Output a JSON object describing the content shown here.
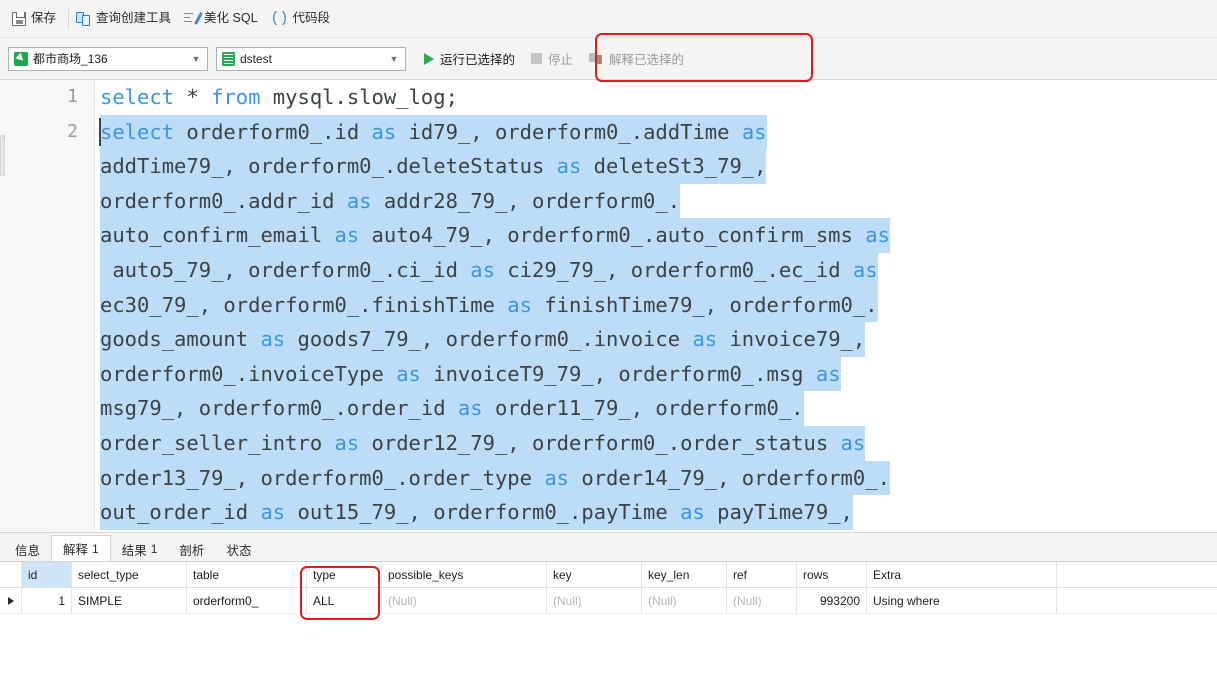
{
  "toolbar_top": {
    "items": [
      {
        "label": "保存",
        "icon": "save-icon"
      },
      {
        "label": "查询创建工具",
        "icon": "query-builder-icon"
      },
      {
        "label": "美化 SQL",
        "icon": "beautify-sql-icon"
      },
      {
        "label": "代码段",
        "icon": "code-snippet-icon"
      }
    ]
  },
  "toolbar_second": {
    "connection": {
      "value": "都市商场_136",
      "icon": "connection-icon",
      "arrow": "▼"
    },
    "database": {
      "value": "dstest",
      "icon": "database-icon",
      "arrow": "▼"
    },
    "run_selected": {
      "label": "运行已选择的",
      "icon": "run-icon",
      "enabled": true
    },
    "stop": {
      "label": "停止",
      "icon": "stop-icon",
      "enabled": false
    },
    "explain_selected": {
      "label": "解释已选择的",
      "icon": "explain-icon",
      "enabled": false
    }
  },
  "editor": {
    "lines": [
      {
        "number": "1",
        "selected": false,
        "parts": [
          {
            "t": "select",
            "k": true
          },
          {
            "t": " * ",
            "k": false
          },
          {
            "t": "from",
            "k": true
          },
          {
            "t": " mysql.slow_log;",
            "k": false
          }
        ]
      },
      {
        "number": "2",
        "selected": true,
        "parts": [
          {
            "t": "select",
            "k": true
          },
          {
            "t": " orderform0_.id ",
            "k": false
          },
          {
            "t": "as",
            "k": true
          },
          {
            "t": " id79_, orderform0_.addTime ",
            "k": false
          },
          {
            "t": "as",
            "k": true
          }
        ]
      },
      {
        "number": "",
        "selected": true,
        "parts": [
          {
            "t": "addTime79_, orderform0_.deleteStatus ",
            "k": false
          },
          {
            "t": "as",
            "k": true
          },
          {
            "t": " deleteSt3_79_,",
            "k": false
          }
        ]
      },
      {
        "number": "",
        "selected": true,
        "parts": [
          {
            "t": "orderform0_.addr_id ",
            "k": false
          },
          {
            "t": "as",
            "k": true
          },
          {
            "t": " addr28_79_, orderform0_.",
            "k": false
          }
        ]
      },
      {
        "number": "",
        "selected": true,
        "parts": [
          {
            "t": "auto_confirm_email ",
            "k": false
          },
          {
            "t": "as",
            "k": true
          },
          {
            "t": " auto4_79_, orderform0_.auto_confirm_sms ",
            "k": false
          },
          {
            "t": "as",
            "k": true
          }
        ]
      },
      {
        "number": "",
        "selected": true,
        "parts": [
          {
            "t": " auto5_79_, orderform0_.ci_id ",
            "k": false
          },
          {
            "t": "as",
            "k": true
          },
          {
            "t": " ci29_79_, orderform0_.ec_id ",
            "k": false
          },
          {
            "t": "as",
            "k": true
          }
        ]
      },
      {
        "number": "",
        "selected": true,
        "parts": [
          {
            "t": "ec30_79_, orderform0_.finishTime ",
            "k": false
          },
          {
            "t": "as",
            "k": true
          },
          {
            "t": " finishTime79_, orderform0_.",
            "k": false
          }
        ]
      },
      {
        "number": "",
        "selected": true,
        "parts": [
          {
            "t": "goods_amount ",
            "k": false
          },
          {
            "t": "as",
            "k": true
          },
          {
            "t": " goods7_79_, orderform0_.invoice ",
            "k": false
          },
          {
            "t": "as",
            "k": true
          },
          {
            "t": " invoice79_,",
            "k": false
          }
        ]
      },
      {
        "number": "",
        "selected": true,
        "parts": [
          {
            "t": "orderform0_.invoiceType ",
            "k": false
          },
          {
            "t": "as",
            "k": true
          },
          {
            "t": " invoiceT9_79_, orderform0_.msg ",
            "k": false
          },
          {
            "t": "as",
            "k": true
          }
        ]
      },
      {
        "number": "",
        "selected": true,
        "parts": [
          {
            "t": "msg79_, orderform0_.order_id ",
            "k": false
          },
          {
            "t": "as",
            "k": true
          },
          {
            "t": " order11_79_, orderform0_.",
            "k": false
          }
        ]
      },
      {
        "number": "",
        "selected": true,
        "parts": [
          {
            "t": "order_seller_intro ",
            "k": false
          },
          {
            "t": "as",
            "k": true
          },
          {
            "t": " order12_79_, orderform0_.order_status ",
            "k": false
          },
          {
            "t": "as",
            "k": true
          }
        ]
      },
      {
        "number": "",
        "selected": true,
        "parts": [
          {
            "t": "order13_79_, orderform0_.order_type ",
            "k": false
          },
          {
            "t": "as",
            "k": true
          },
          {
            "t": " order14_79_, orderform0_.",
            "k": false
          }
        ]
      },
      {
        "number": "",
        "selected": true,
        "parts": [
          {
            "t": "out_order_id ",
            "k": false
          },
          {
            "t": "as",
            "k": true
          },
          {
            "t": " out15_79_, orderform0_.payTime ",
            "k": false
          },
          {
            "t": "as",
            "k": true
          },
          {
            "t": " payTime79_,",
            "k": false
          }
        ]
      }
    ]
  },
  "result": {
    "tabs": [
      {
        "label": "信息",
        "badge": "",
        "active": false
      },
      {
        "label": "解释",
        "badge": "1",
        "active": true
      },
      {
        "label": "结果",
        "badge": "1",
        "active": false
      },
      {
        "label": "剖析",
        "badge": "",
        "active": false
      },
      {
        "label": "状态",
        "badge": "",
        "active": false
      }
    ],
    "columns": [
      "id",
      "select_type",
      "table",
      "type",
      "possible_keys",
      "key",
      "key_len",
      "ref",
      "rows",
      "Extra"
    ],
    "rows": [
      {
        "id": "1",
        "select_type": "SIMPLE",
        "table": "orderform0_",
        "type": "ALL",
        "possible_keys": "(Null)",
        "key": "(Null)",
        "key_len": "(Null)",
        "ref": "(Null)",
        "rows": "993200",
        "Extra": "Using where"
      }
    ]
  },
  "annotations": {
    "color": "#e01b1b",
    "boxes": [
      {
        "name": "explain-selected-highlight"
      },
      {
        "name": "type-column-highlight"
      }
    ]
  }
}
